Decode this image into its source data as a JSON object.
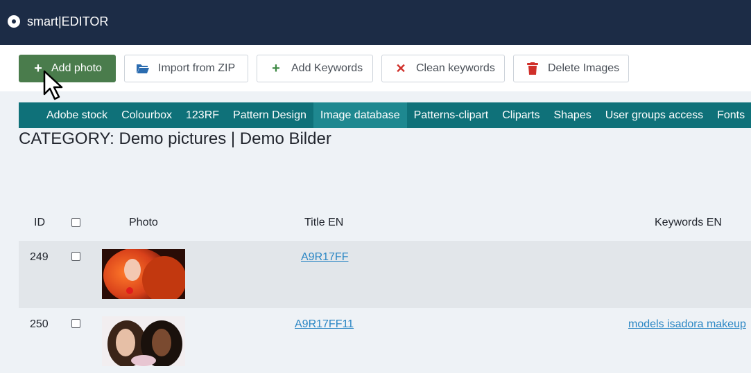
{
  "app": {
    "title": "smart|EDITOR"
  },
  "toolbar": {
    "add_photo": "Add photo",
    "import_zip": "Import from ZIP",
    "add_keywords": "Add Keywords",
    "clean_keywords": "Clean keywords",
    "delete_images": "Delete Images"
  },
  "nav": {
    "items": [
      "Adobe stock",
      "Colourbox",
      "123RF",
      "Pattern Design",
      "Image database",
      "Patterns-clipart",
      "Cliparts",
      "Shapes",
      "User groups access",
      "Fonts"
    ],
    "active": "Image database"
  },
  "category": {
    "heading": "CATEGORY: Demo pictures | Demo Bilder"
  },
  "table": {
    "headers": {
      "id": "ID",
      "photo": "Photo",
      "title": "Title EN",
      "keywords": "Keywords EN"
    },
    "rows": [
      {
        "id": "249",
        "title": "A9R17FF",
        "keywords": ""
      },
      {
        "id": "250",
        "title": "A9R17FF11",
        "keywords": "models isadora makeup"
      }
    ]
  },
  "colors": {
    "topbar": "#1c2c46",
    "nav": "#0f7179",
    "nav_active": "#1e8890",
    "primary_button": "#4a7c4c",
    "link": "#2a86c4",
    "delete_icon": "#d0302a"
  }
}
